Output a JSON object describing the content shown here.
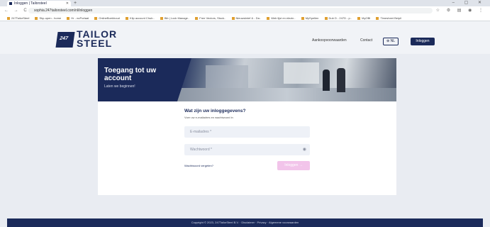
{
  "browser": {
    "tab_title": "Inloggen | Tailorsteel",
    "new_tab": "+",
    "window_controls": "– ▢ ✕",
    "url": "sophia.247tailorsteel.com/nl/inloggen",
    "nav": "← → C",
    "toolbar_icons": "☆ ⚙ ▤ ◉ ⋮",
    "bookmarks": [
      "247TailorSteel",
      "Skp-open - home",
      "Hr - nuPortaal",
      "OnlineBoekhoud",
      "Klip account Chub..",
      "Bib | Lock Manage..",
      "Free Vectors, Stock..",
      "Nieuwsbrief & - Da..",
      "Web lijst en elezin..",
      "MySpellen",
      "Dub D - 247D - p..",
      "MyOBI",
      "Timesheet Beipil"
    ]
  },
  "header": {
    "logo_prefix": "247",
    "logo_line1": "TAILOR",
    "logo_line2": "STEEL",
    "nav_specs": "Aankoopvoorwaarden",
    "nav_contact": "Contact",
    "lang": "⊕ NL",
    "login": "Inloggen"
  },
  "hero": {
    "title": "Toegang tot uw account",
    "subtitle": "Laten we beginnen!"
  },
  "form": {
    "title": "Wat zijn uw inloggegevens?",
    "subtitle": "Voer uw e-mailadres en wachtwoord in",
    "email_placeholder": "E-mailadres *",
    "password_placeholder": "Wachtwoord *",
    "forgot": "Wachtwoord vergeten?",
    "submit": "Inloggen →"
  },
  "footer": {
    "text": "Copyright © 2023, 247TailorSteel B.V.  ·  Disclaimer  ·  Privacy  ·  Algemene voorwaarden"
  }
}
